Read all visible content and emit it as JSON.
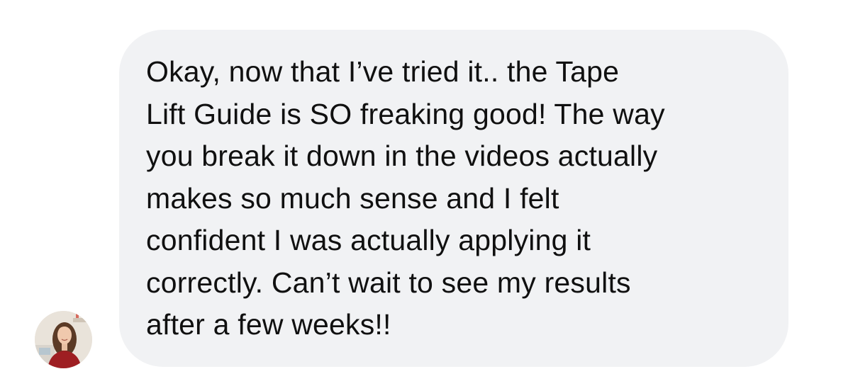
{
  "conversation": {
    "message": {
      "lines": [
        "Okay, now that I’ve tried it.. the Tape",
        "Lift Guide is SO freaking good! The way",
        "you break it down in the videos actually",
        "makes so much sense and I felt",
        "confident I was actually applying it",
        "correctly. Can’t wait to see my results",
        "after a few weeks!!"
      ],
      "bubble_color": "#f1f2f4",
      "text_color": "#101010"
    },
    "sender": {
      "avatar_icon": "person-photo-avatar"
    }
  }
}
